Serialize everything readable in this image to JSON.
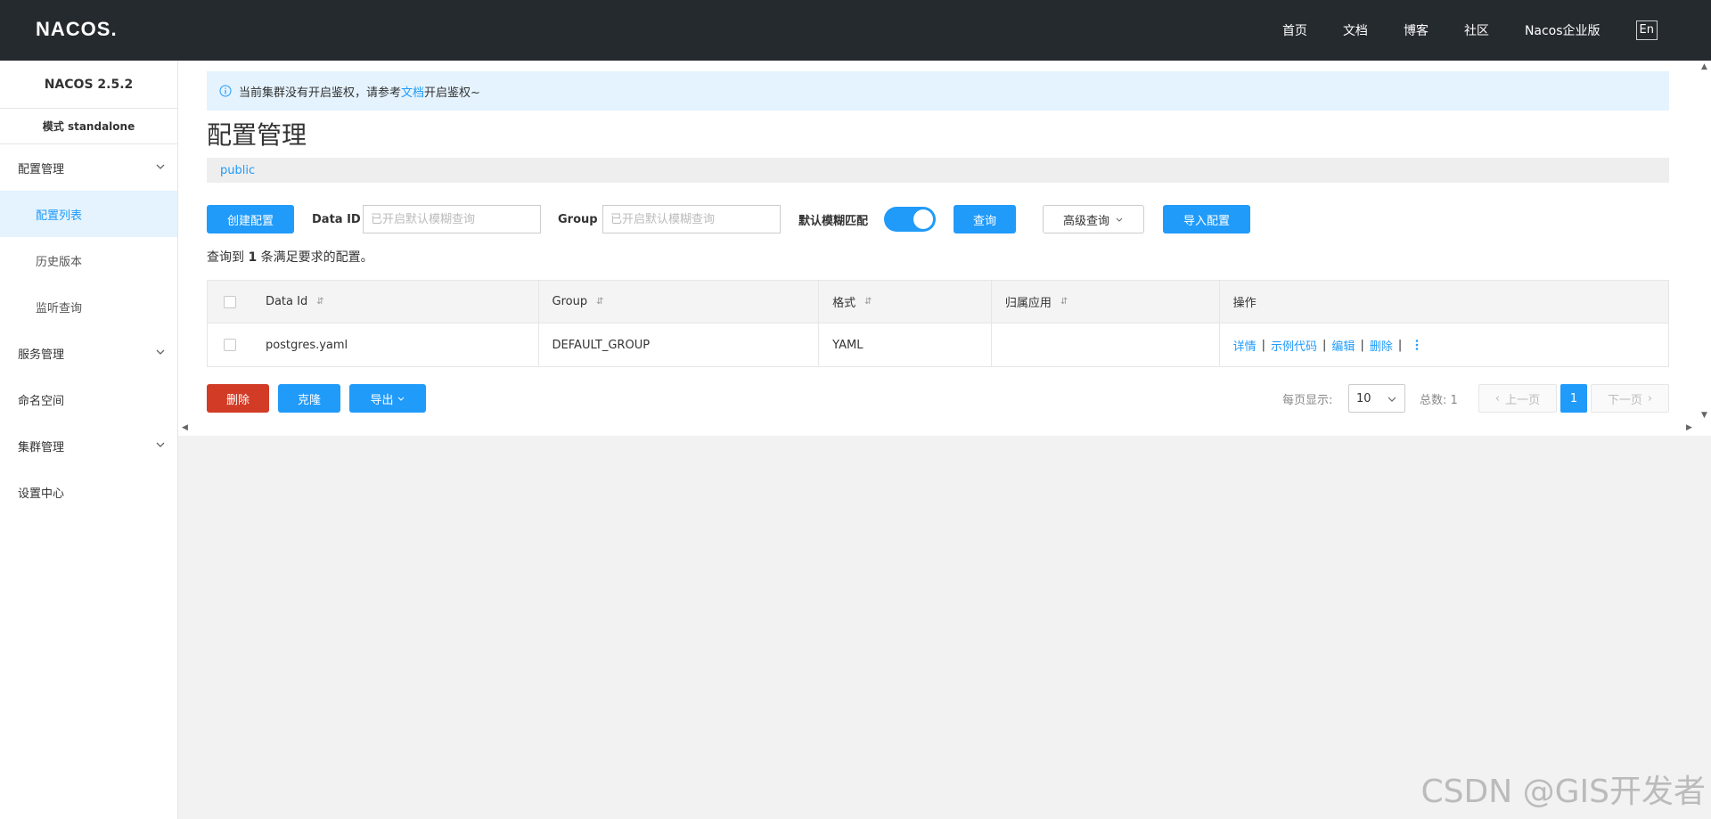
{
  "header": {
    "logo": "NACOS.",
    "nav": [
      "首页",
      "文档",
      "博客",
      "社区",
      "Nacos企业版"
    ],
    "lang": "En"
  },
  "sidebar": {
    "version": "NACOS 2.5.2",
    "mode": "模式 standalone",
    "items": [
      {
        "label": "配置管理",
        "type": "group"
      },
      {
        "label": "配置列表",
        "type": "sub-active"
      },
      {
        "label": "历史版本",
        "type": "sub"
      },
      {
        "label": "监听查询",
        "type": "sub"
      },
      {
        "label": "服务管理",
        "type": "group"
      },
      {
        "label": "命名空间",
        "type": "item"
      },
      {
        "label": "集群管理",
        "type": "group"
      },
      {
        "label": "设置中心",
        "type": "item"
      }
    ]
  },
  "notice": {
    "prefix": "当前集群没有开启鉴权，请参考",
    "link": "文档",
    "suffix": "开启鉴权~"
  },
  "page": {
    "title": "配置管理",
    "namespace": "public"
  },
  "filters": {
    "create_button": "创建配置",
    "data_id_label": "Data ID",
    "data_id_placeholder": "已开启默认模糊查询",
    "group_label": "Group",
    "group_placeholder": "已开启默认模糊查询",
    "fuzzy_label": "默认模糊匹配",
    "fuzzy_enabled": true,
    "query_button": "查询",
    "advanced_button": "高级查询",
    "import_button": "导入配置"
  },
  "result": {
    "prefix": "查询到",
    "count": "1",
    "suffix": "条满足要求的配置。"
  },
  "table": {
    "columns": [
      "Data Id",
      "Group",
      "格式",
      "归属应用",
      "操作"
    ],
    "rows": [
      {
        "data_id": "postgres.yaml",
        "group": "DEFAULT_GROUP",
        "format": "YAML",
        "app": ""
      }
    ],
    "actions": [
      "详情",
      "示例代码",
      "编辑",
      "删除"
    ]
  },
  "bottom": {
    "delete_button": "删除",
    "clone_button": "克隆",
    "export_button": "导出",
    "page_size_label": "每页显示:",
    "page_size": "10",
    "total_label": "总数: 1",
    "prev": "上一页",
    "current_page": "1",
    "next": "下一页"
  },
  "watermark": "CSDN @GIS开发者",
  "colors": {
    "primary": "#209bfa",
    "danger": "#d23c26",
    "header_bg": "#252a2f"
  }
}
